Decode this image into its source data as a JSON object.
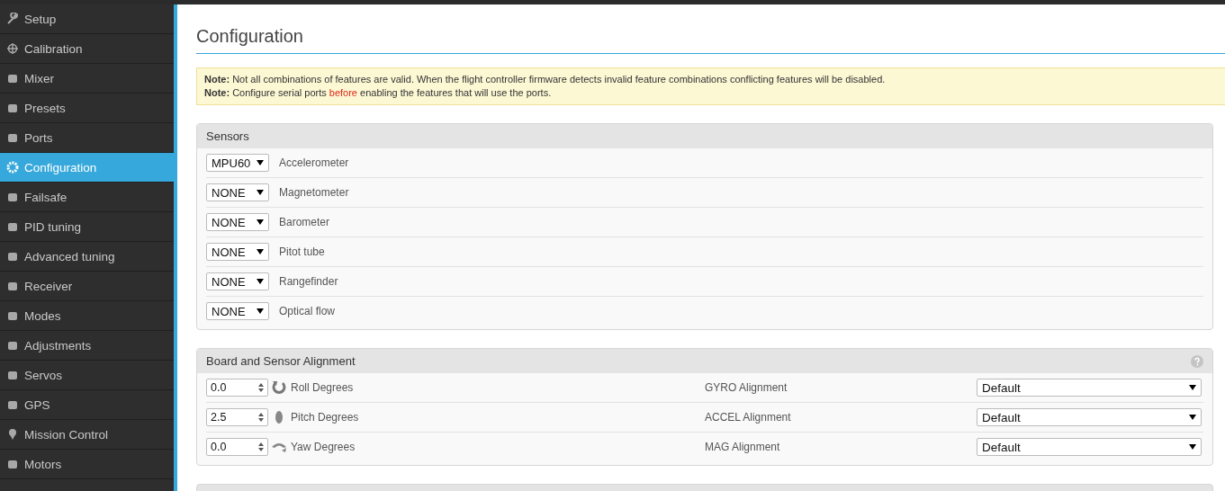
{
  "sidebar": {
    "items": [
      {
        "label": "Setup",
        "selected": false
      },
      {
        "label": "Calibration",
        "selected": false
      },
      {
        "label": "Mixer",
        "selected": false
      },
      {
        "label": "Presets",
        "selected": false
      },
      {
        "label": "Ports",
        "selected": false
      },
      {
        "label": "Configuration",
        "selected": true
      },
      {
        "label": "Failsafe",
        "selected": false
      },
      {
        "label": "PID tuning",
        "selected": false
      },
      {
        "label": "Advanced tuning",
        "selected": false
      },
      {
        "label": "Receiver",
        "selected": false
      },
      {
        "label": "Modes",
        "selected": false
      },
      {
        "label": "Adjustments",
        "selected": false
      },
      {
        "label": "Servos",
        "selected": false
      },
      {
        "label": "GPS",
        "selected": false
      },
      {
        "label": "Mission Control",
        "selected": false
      },
      {
        "label": "Motors",
        "selected": false
      }
    ]
  },
  "page": {
    "title": "Configuration"
  },
  "notes": [
    {
      "parts": [
        {
          "text": "**Note:** Not all combinations of features are valid. When the flight controller firmware detects invalid feature combinations conflicting features will be disabled.",
          "highlight": false
        }
      ]
    },
    {
      "parts": [
        {
          "text": "**Note:** Configure serial ports ",
          "highlight": false
        },
        {
          "text": "before",
          "highlight": true
        },
        {
          "text": " enabling the features that will use the ports.",
          "highlight": false
        }
      ]
    }
  ],
  "sensors": {
    "title": "Sensors",
    "rows": [
      {
        "value": "MPU60",
        "label": "Accelerometer"
      },
      {
        "value": "NONE",
        "label": "Magnetometer"
      },
      {
        "value": "NONE",
        "label": "Barometer"
      },
      {
        "value": "NONE",
        "label": "Pitot tube"
      },
      {
        "value": "NONE",
        "label": "Rangefinder"
      },
      {
        "value": "NONE",
        "label": "Optical flow"
      }
    ]
  },
  "alignment": {
    "title": "Board and Sensor Alignment",
    "rows": [
      {
        "value": "0.0",
        "label": "Roll Degrees",
        "sensor_label": "GYRO Alignment",
        "sensor_value": "Default"
      },
      {
        "value": "2.5",
        "label": "Pitch Degrees",
        "sensor_label": "ACCEL Alignment",
        "sensor_value": "Default"
      },
      {
        "value": "0.0",
        "label": "Yaw Degrees",
        "sensor_label": "MAG Alignment",
        "sensor_value": "Default"
      }
    ]
  }
}
